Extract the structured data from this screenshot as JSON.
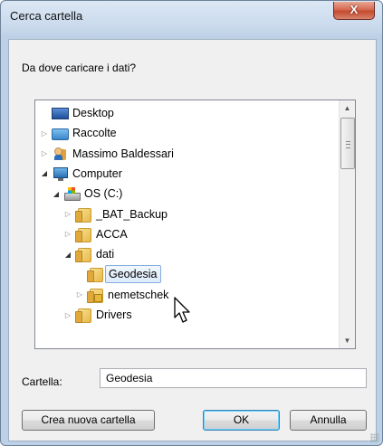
{
  "window": {
    "title": "Cerca cartella",
    "close_glyph": "X"
  },
  "prompt": "Da dove caricare i dati?",
  "tree": {
    "items": [
      {
        "label": "Desktop",
        "icon": "desktop-icon",
        "expander": "",
        "level": 0
      },
      {
        "label": "Raccolte",
        "icon": "libraries-icon",
        "expander": "collapsed",
        "level": 0
      },
      {
        "label": "Massimo Baldessari",
        "icon": "user-folder-icon",
        "expander": "collapsed",
        "level": 0
      },
      {
        "label": "Computer",
        "icon": "computer-icon",
        "expander": "expanded",
        "level": 0
      },
      {
        "label": "OS (C:)",
        "icon": "drive-icon",
        "expander": "expanded",
        "level": 1
      },
      {
        "label": "_BAT_Backup",
        "icon": "folder-icon",
        "expander": "collapsed",
        "level": 2
      },
      {
        "label": "ACCA",
        "icon": "folder-icon",
        "expander": "collapsed",
        "level": 2
      },
      {
        "label": "dati",
        "icon": "folder-icon",
        "expander": "expanded",
        "level": 2
      },
      {
        "label": "Geodesia",
        "icon": "folder-icon",
        "expander": "",
        "level": 3,
        "selected": true
      },
      {
        "label": "nemetschek",
        "icon": "locked-folder-icon",
        "expander": "collapsed",
        "level": 3
      },
      {
        "label": "Drivers",
        "icon": "folder-icon",
        "expander": "collapsed",
        "level": 2
      }
    ]
  },
  "folder_field": {
    "label": "Cartella:",
    "value": "Geodesia"
  },
  "buttons": {
    "new_folder": "Crea nuova cartella",
    "ok": "OK",
    "cancel": "Annulla"
  }
}
